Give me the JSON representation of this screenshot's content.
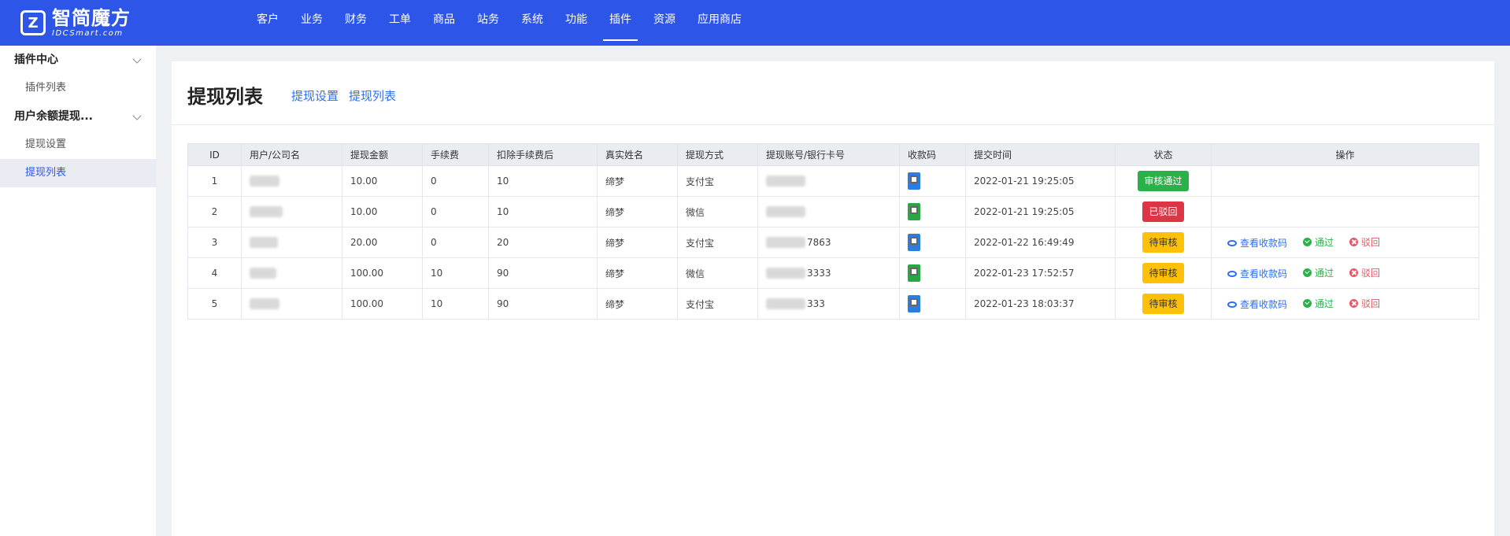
{
  "brand": {
    "logo_glyph": "Z",
    "name_cn": "智简魔方",
    "name_en": "IDCSmart.com"
  },
  "nav": [
    {
      "label": "客户"
    },
    {
      "label": "业务"
    },
    {
      "label": "财务"
    },
    {
      "label": "工单"
    },
    {
      "label": "商品"
    },
    {
      "label": "站务"
    },
    {
      "label": "系统"
    },
    {
      "label": "功能"
    },
    {
      "label": "插件",
      "active": true
    },
    {
      "label": "资源"
    },
    {
      "label": "应用商店"
    }
  ],
  "sidebar": {
    "groups": [
      {
        "label": "插件中心",
        "items": [
          {
            "label": "插件列表"
          }
        ]
      },
      {
        "label": "用户余额提现...",
        "items": [
          {
            "label": "提现设置"
          },
          {
            "label": "提现列表",
            "active": true
          }
        ]
      }
    ]
  },
  "page": {
    "title": "提现列表",
    "links": [
      "提现设置",
      "提现列表"
    ]
  },
  "table": {
    "columns": [
      "ID",
      "用户/公司名",
      "提现金额",
      "手续费",
      "扣除手续费后",
      "真实姓名",
      "提现方式",
      "提现账号/银行卡号",
      "收款码",
      "提交时间",
      "状态",
      "操作"
    ],
    "rows": [
      {
        "id": "1",
        "amount": "10.00",
        "fee": "0",
        "net": "10",
        "real_name": "缔梦",
        "method": "支付宝",
        "account": "",
        "qr": "blue",
        "time": "2022-01-21 19:25:05",
        "status": "审核通过",
        "status_color": "green",
        "actions": false
      },
      {
        "id": "2",
        "amount": "10.00",
        "fee": "0",
        "net": "10",
        "real_name": "缔梦",
        "method": "微信",
        "account": "",
        "qr": "green",
        "time": "2022-01-21 19:25:05",
        "status": "已驳回",
        "status_color": "red",
        "actions": false
      },
      {
        "id": "3",
        "amount": "20.00",
        "fee": "0",
        "net": "20",
        "real_name": "缔梦",
        "method": "支付宝",
        "account": "7863",
        "qr": "blue",
        "time": "2022-01-22 16:49:49",
        "status": "待审核",
        "status_color": "yellow",
        "actions": true
      },
      {
        "id": "4",
        "amount": "100.00",
        "fee": "10",
        "net": "90",
        "real_name": "缔梦",
        "method": "微信",
        "account": "3333",
        "qr": "green",
        "time": "2022-01-23 17:52:57",
        "status": "待审核",
        "status_color": "yellow",
        "actions": true
      },
      {
        "id": "5",
        "amount": "100.00",
        "fee": "10",
        "net": "90",
        "real_name": "缔梦",
        "method": "支付宝",
        "account": "333",
        "qr": "blue",
        "time": "2022-01-23 18:03:37",
        "status": "待审核",
        "status_color": "yellow",
        "actions": true
      }
    ],
    "action_labels": {
      "view": "查看收款码",
      "pass": "通过",
      "reject": "驳回"
    }
  },
  "colors": {
    "topbar": "#2d55e8",
    "link": "#2d6ff0",
    "success": "#2bb14a",
    "danger": "#dc3545",
    "warning": "#ffc107"
  }
}
